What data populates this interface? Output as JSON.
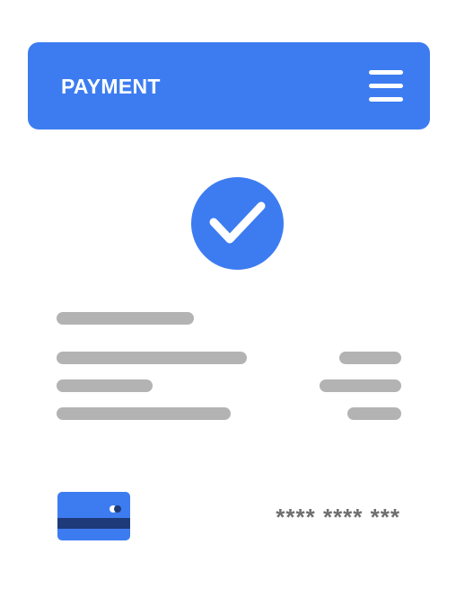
{
  "header": {
    "title": "PAYMENT",
    "menu_icon": "hamburger-menu-icon"
  },
  "status": {
    "icon": "checkmark-icon"
  },
  "card": {
    "icon": "credit-card-icon",
    "masked_number": "**** **** ***"
  },
  "colors": {
    "accent": "#3d7cf0",
    "card_stripe": "#1f3a78",
    "placeholder": "#b3b3b3",
    "text_muted": "#6f6f6f"
  }
}
